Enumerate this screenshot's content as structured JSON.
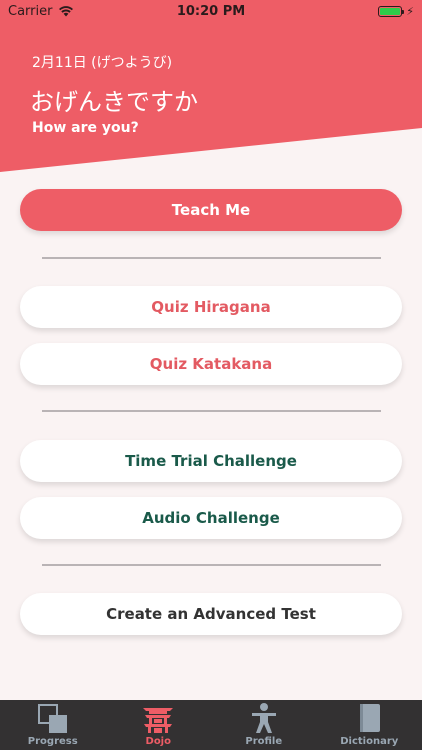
{
  "status_bar": {
    "carrier": "Carrier",
    "time": "10:20 PM"
  },
  "header": {
    "date": "2月11日 (げつようび)",
    "greeting": "おげんきですか",
    "translation": "How are you?"
  },
  "buttons": {
    "teach_me": "Teach Me",
    "quiz_hiragana": "Quiz Hiragana",
    "quiz_katakana": "Quiz Katakana",
    "time_trial": "Time Trial Challenge",
    "audio_challenge": "Audio Challenge",
    "advanced_test": "Create an Advanced Test"
  },
  "tabs": [
    {
      "label": "Progress",
      "icon": "progress-icon",
      "active": false
    },
    {
      "label": "Dojo",
      "icon": "dojo-icon",
      "active": true
    },
    {
      "label": "Profile",
      "icon": "profile-icon",
      "active": false
    },
    {
      "label": "Dictionary",
      "icon": "dictionary-icon",
      "active": false
    }
  ],
  "colors": {
    "accent": "#ee5d66",
    "background": "#faf3f3",
    "green_text": "#1a5a4a",
    "tabbar": "#333132",
    "tab_inactive": "#9aa7b3"
  }
}
